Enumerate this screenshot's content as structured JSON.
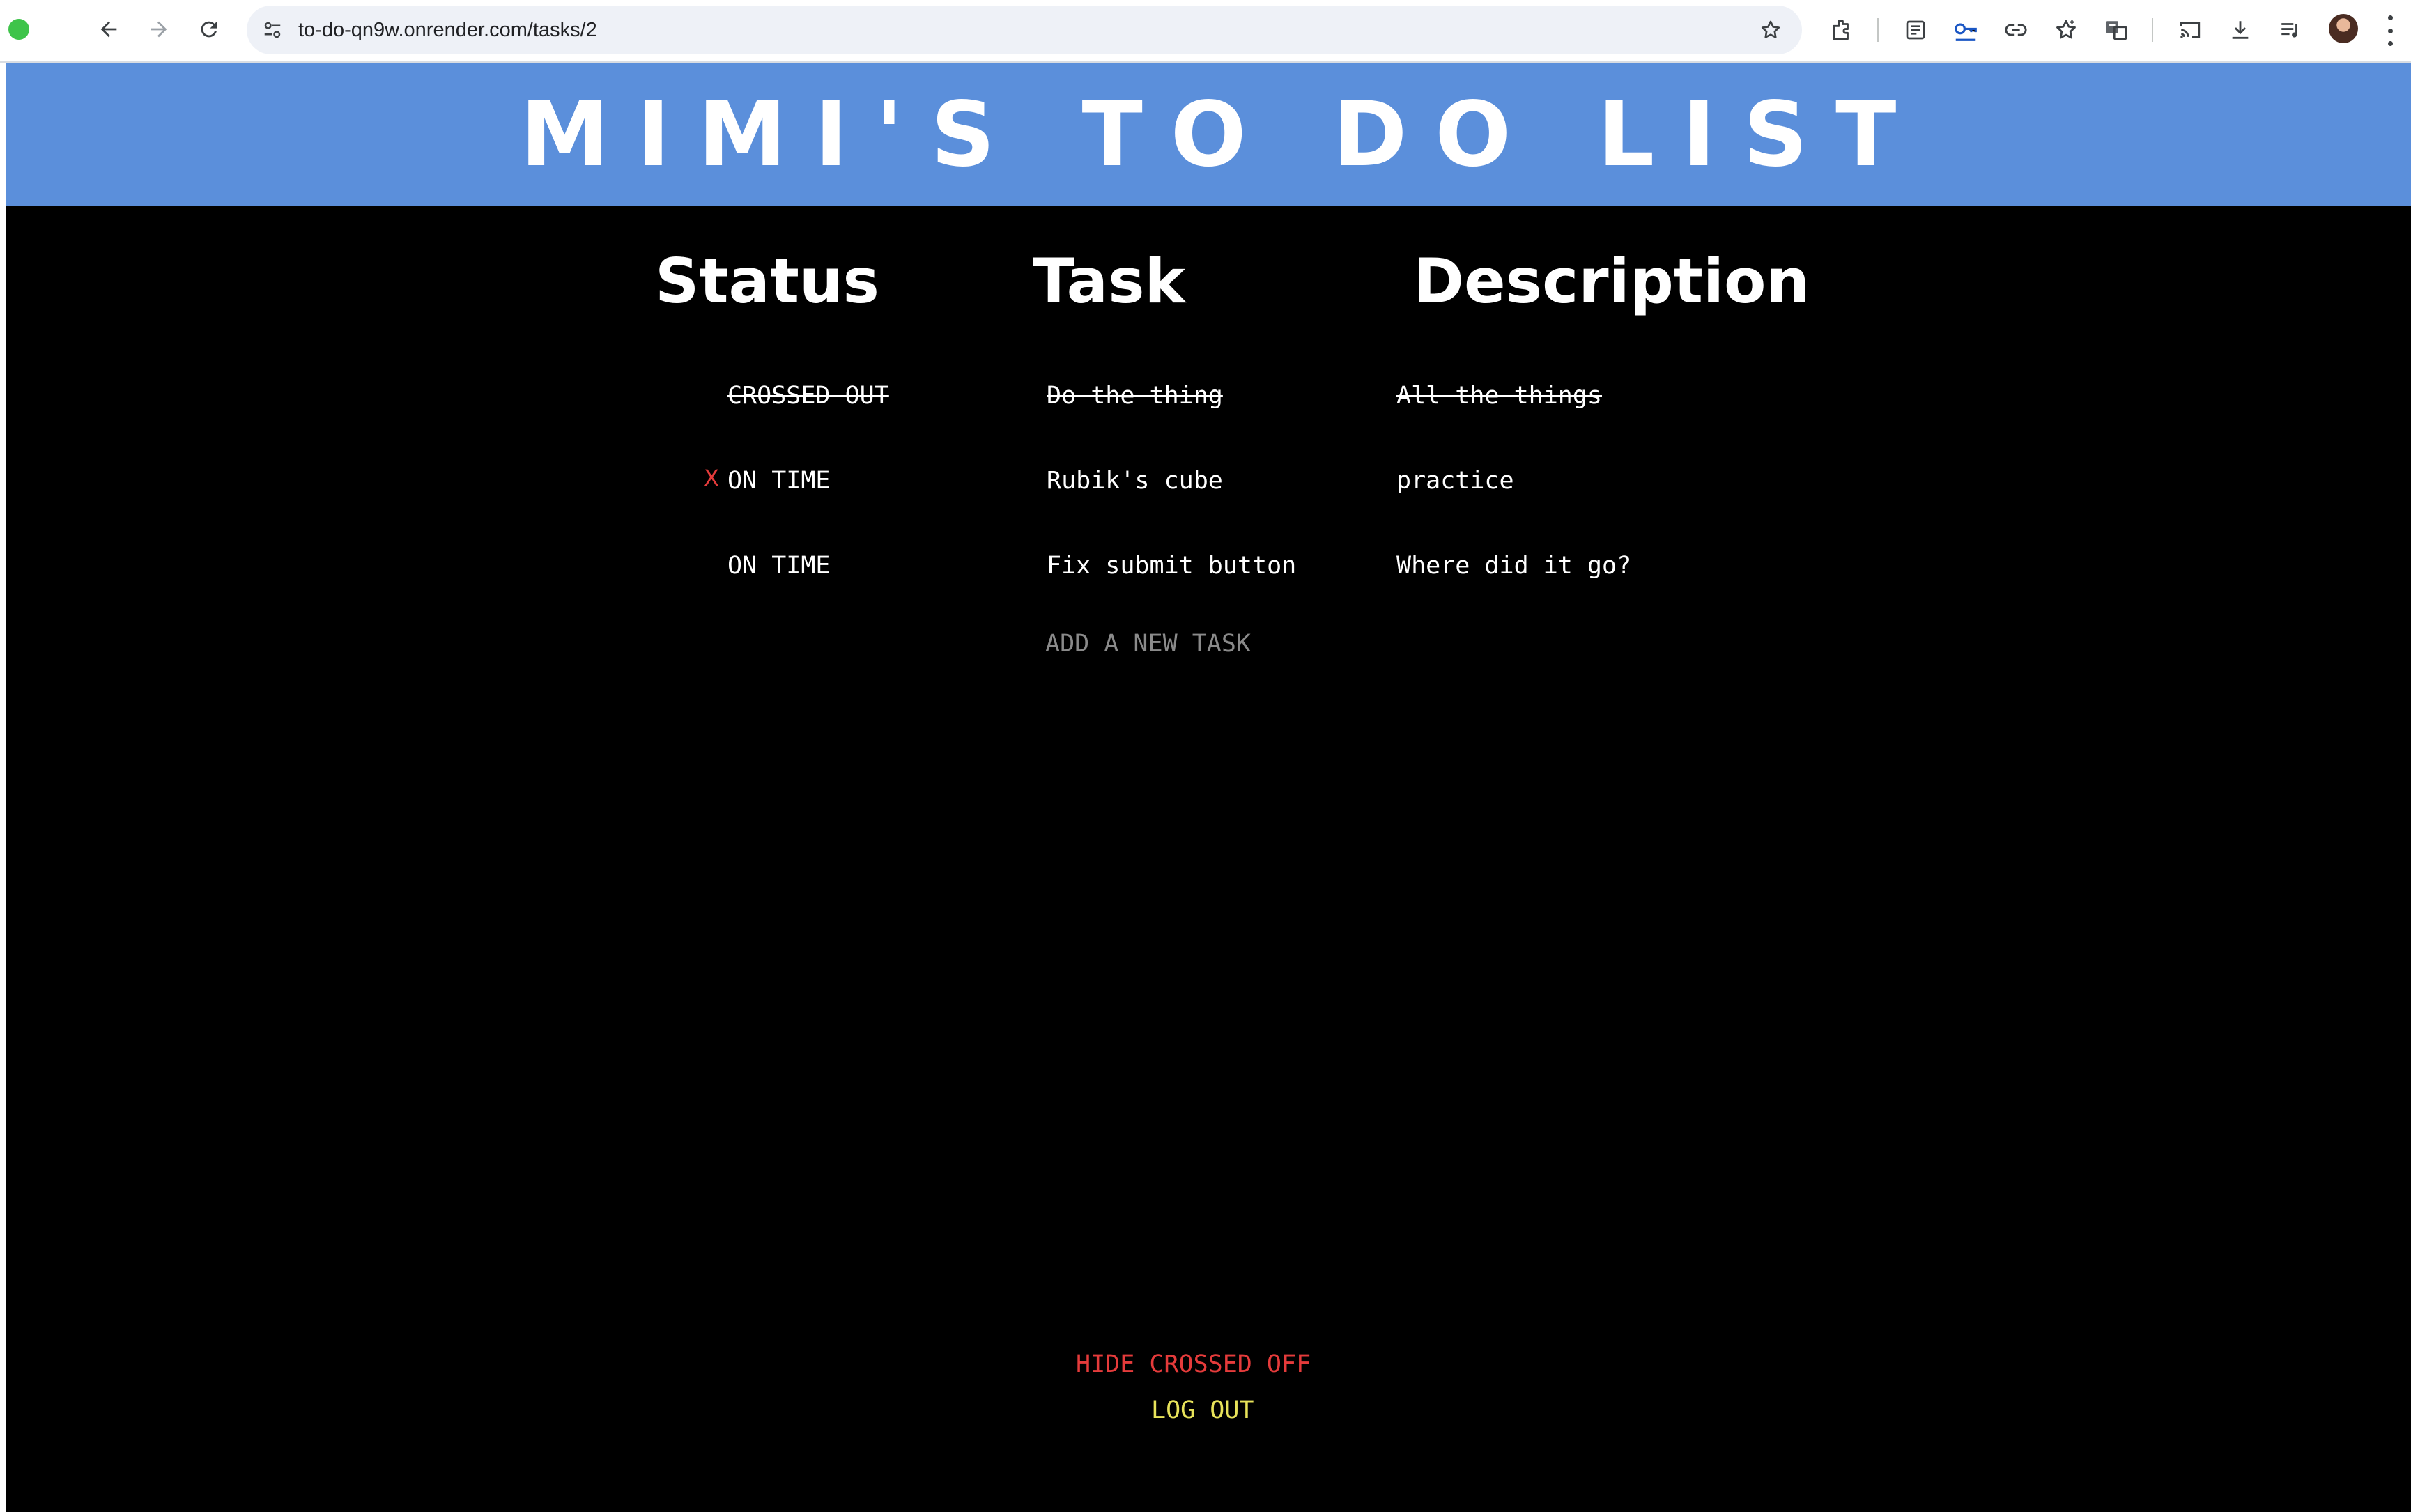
{
  "browser": {
    "url": "to-do-qn9w.onrender.com/tasks/2"
  },
  "header": {
    "title": "MIMI'S TO DO LIST"
  },
  "table": {
    "columns": [
      "Status",
      "Task",
      "Description"
    ],
    "rows": [
      {
        "status": "CROSSED OUT",
        "task": "Do the thing",
        "description": "All the things",
        "crossed_out": true,
        "delete_mark": ""
      },
      {
        "status": "ON TIME",
        "task": "Rubik's cube",
        "description": "practice",
        "crossed_out": false,
        "delete_mark": "X"
      },
      {
        "status": "ON TIME",
        "task": "Fix submit button",
        "description": "Where did it go?",
        "crossed_out": false,
        "delete_mark": ""
      }
    ]
  },
  "actions": {
    "add_task": "ADD A NEW TASK",
    "hide_crossed": "HIDE CROSSED OFF",
    "log_out": "LOG OUT"
  },
  "colors": {
    "banner": "#5b8fdb",
    "background": "#000000",
    "delete_mark": "#e53b3b",
    "hide_link": "#e53b3b",
    "logout_link": "#e8e35a",
    "add_link": "#8a8a8a"
  }
}
